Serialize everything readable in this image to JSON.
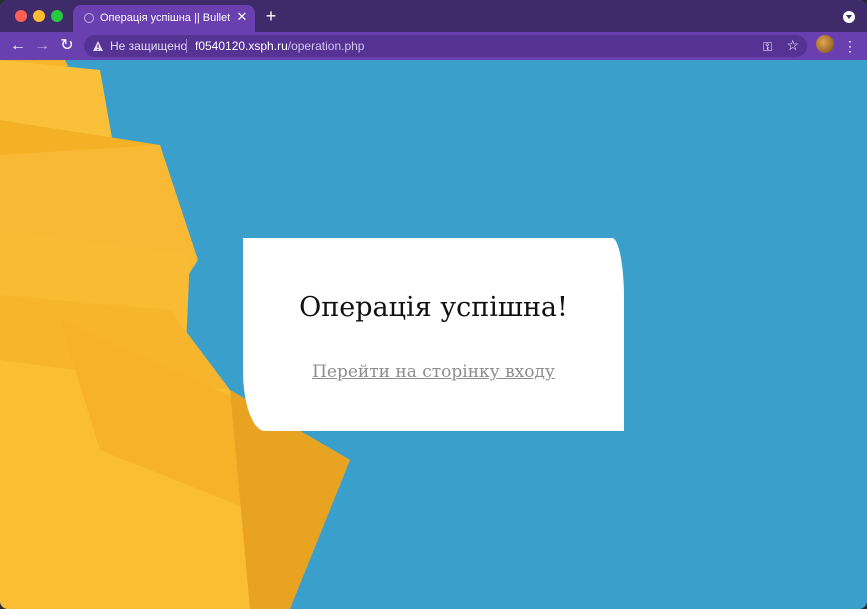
{
  "browser": {
    "tab": {
      "title": "Операція успішна || Bullet"
    },
    "address_bar": {
      "security_label": "Не защищено",
      "host": "f0540120.xsph.ru",
      "path": "/operation.php"
    }
  },
  "page": {
    "heading": "Операція успішна!",
    "login_link": "Перейти на сторінку входу"
  },
  "colors": {
    "tabstrip": "#3f2a6a",
    "toolbar": "#6a3fb0",
    "background": "#3a9fcb",
    "paper": "#f7b82a"
  }
}
